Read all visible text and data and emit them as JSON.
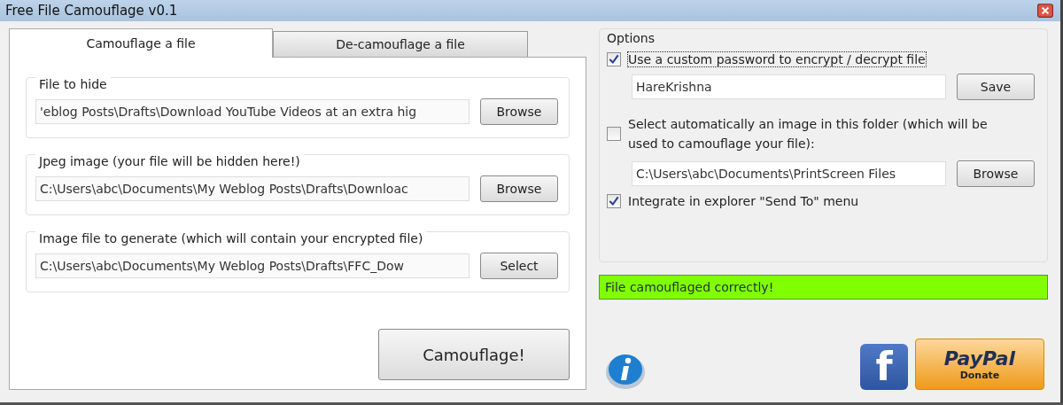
{
  "window": {
    "title": "Free File Camouflage v0.1"
  },
  "tabs": [
    {
      "label": "Camouflage a file",
      "selected": true
    },
    {
      "label": "De-camouflage a file",
      "selected": false
    }
  ],
  "file_groups": [
    {
      "label": "File to hide",
      "value": "'eblog Posts\\Drafts\\Download YouTube Videos at an extra hig",
      "button": "Browse"
    },
    {
      "label": "Jpeg image (your file will be hidden here!)",
      "value": "C:\\Users\\abc\\Documents\\My Weblog Posts\\Drafts\\Downloac",
      "button": "Browse"
    },
    {
      "label": "Image file to generate (which will contain your encrypted file)",
      "value": "C:\\Users\\abc\\Documents\\My Weblog Posts\\Drafts\\FFC_Dow",
      "button": "Select"
    }
  ],
  "camouflage_button": "Camouflage!",
  "options": {
    "title": "Options",
    "password": {
      "label": "Use a custom password to encrypt / decrypt file",
      "checked": true,
      "value": "HareKrishna",
      "button": "Save"
    },
    "auto_image": {
      "label": "Select automatically an image in this folder (which will be used to camouflage your file):",
      "checked": false,
      "value": "C:\\Users\\abc\\Documents\\PrintScreen Files",
      "button": "Browse"
    },
    "send_to": {
      "label": "Integrate in explorer \"Send To\" menu",
      "checked": true
    }
  },
  "status": {
    "text": "File camouflaged correctly!",
    "color": "#80ff00"
  },
  "facebook_button": {
    "label": "f"
  },
  "paypal_button": {
    "label": "PayPal",
    "sublabel": "Donate"
  }
}
